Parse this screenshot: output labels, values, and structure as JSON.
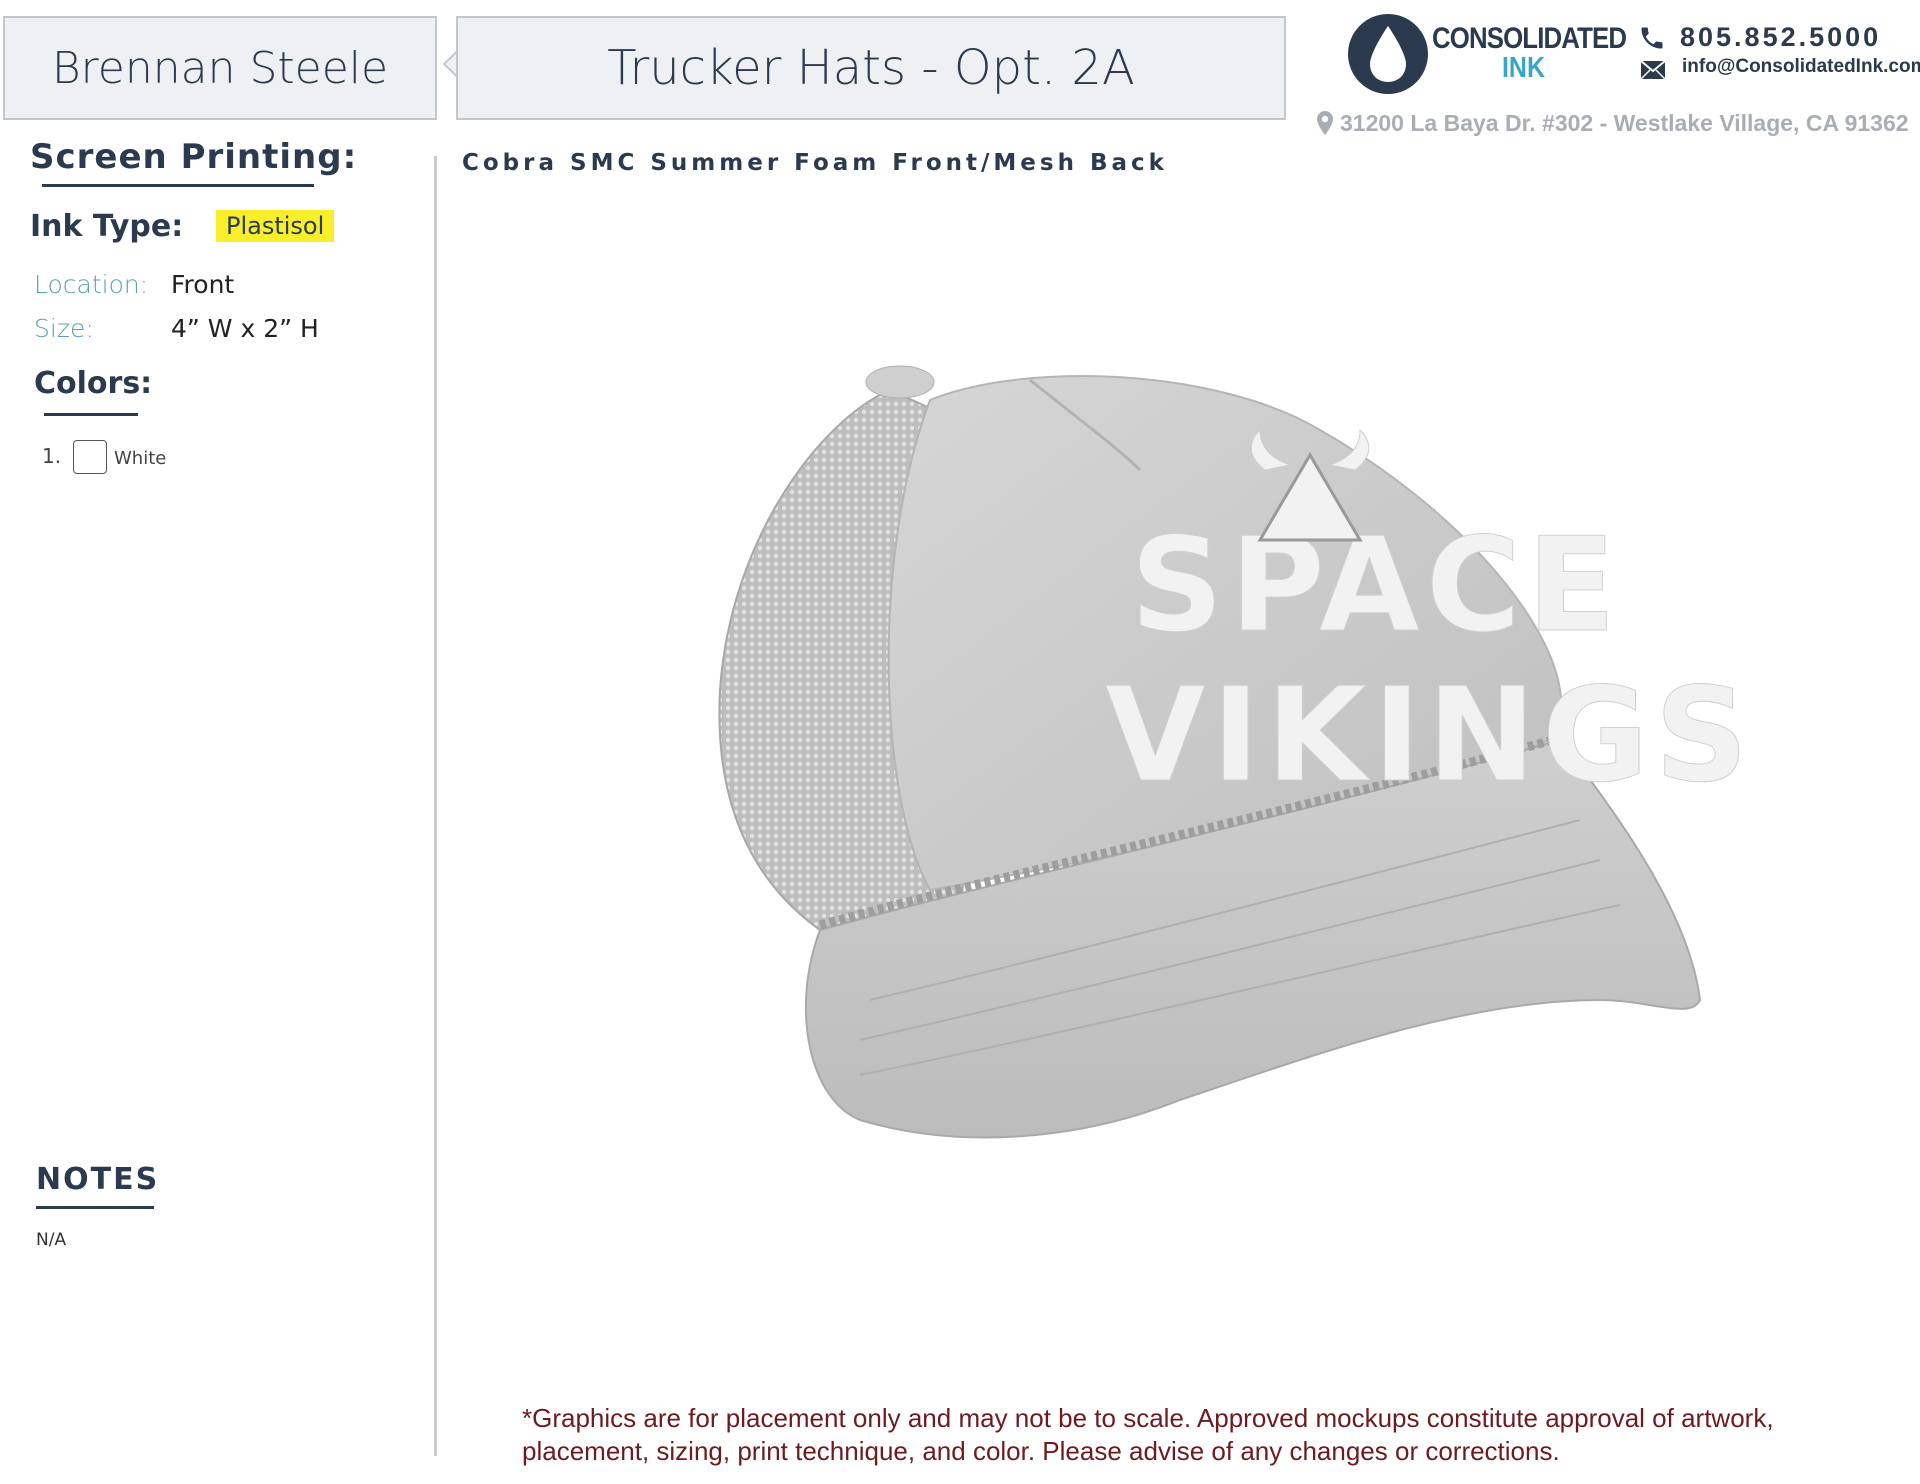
{
  "header": {
    "customer_name": "Brennan Steele",
    "job_title": "Trucker Hats - Opt. 2A"
  },
  "company": {
    "logo_line1": "CONSOLIDATED",
    "logo_line2": "INK",
    "phone": "805.852.5000",
    "email": "info@ConsolidatedInk.com",
    "address": "31200 La Baya Dr. #302 - Westlake Village, CA 91362",
    "brand_color": "#2b3a4e",
    "accent_color": "#3aa6c7"
  },
  "specs": {
    "section_title": "Screen Printing:",
    "ink_type_label": "Ink Type:",
    "ink_type_value": "Plastisol",
    "location_label": "Location:",
    "location_value": "Front",
    "size_label": "Size:",
    "size_value": "4” W x 2” H",
    "colors_title": "Colors:",
    "colors": [
      {
        "number": "1.",
        "name": "White",
        "swatch": "#ffffff"
      }
    ]
  },
  "notes": {
    "title": "NOTES",
    "value": "N/A"
  },
  "product": {
    "name": "Cobra SMC Summer Foam Front/Mesh Back",
    "hat_color": "#c8c8c8",
    "design_text_line1": "SPACE",
    "design_text_line2": "VIKINGS"
  },
  "disclaimer": "*Graphics are for placement only and may not be to scale. Approved mockups constitute approval of artwork, placement, sizing, print technique, and color. Please advise of any changes or corrections.",
  "icons": [
    "phone-icon",
    "mail-icon",
    "map-pin-icon",
    "ink-drop-icon"
  ]
}
